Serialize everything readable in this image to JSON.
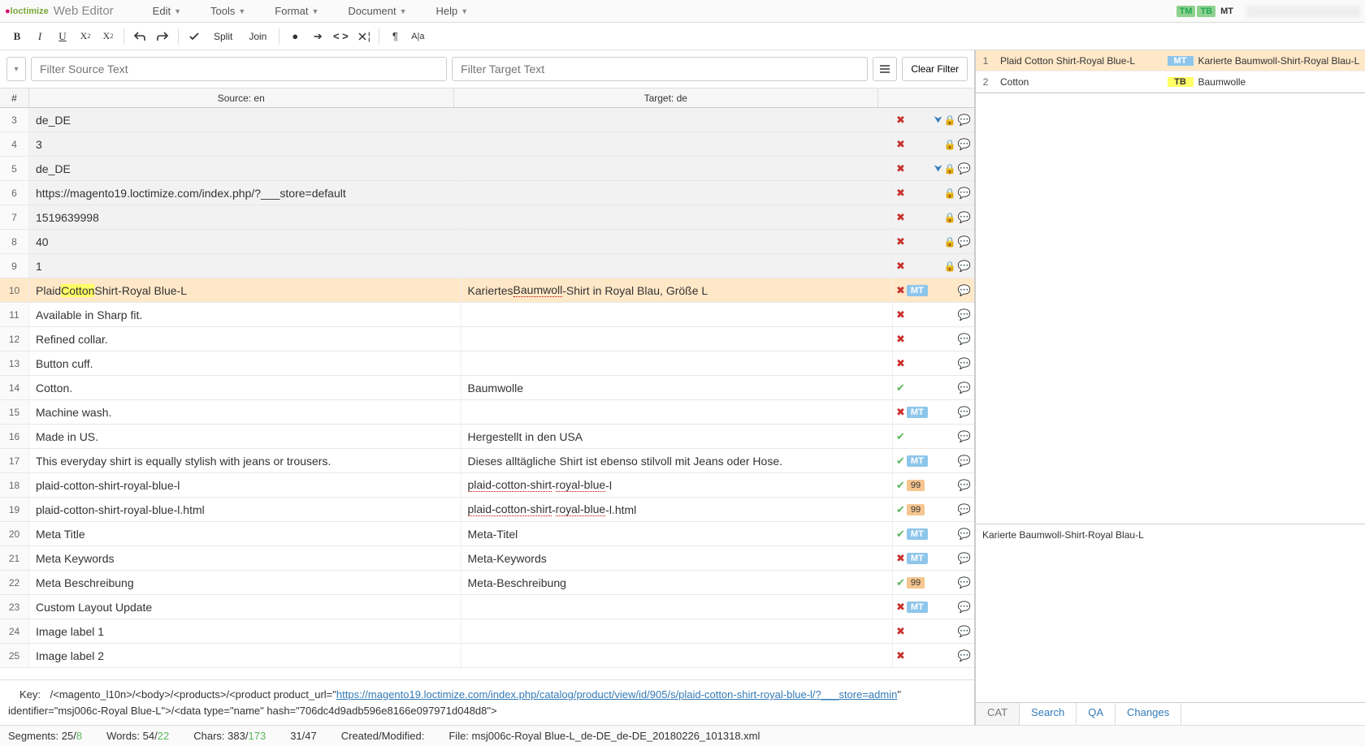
{
  "app": {
    "logo_prefix": "loctimize",
    "title": "Web Editor"
  },
  "menu": [
    "Edit",
    "Tools",
    "Format",
    "Document",
    "Help"
  ],
  "topbadges": [
    "TM",
    "TB",
    "MT"
  ],
  "toolbar": {
    "bold": "B",
    "italic": "I",
    "underline": "U",
    "sub": "X",
    "sup": "X",
    "split": "Split",
    "join": "Join"
  },
  "filters": {
    "source_ph": "Filter Source Text",
    "target_ph": "Filter Target Text",
    "clear": "Clear Filter"
  },
  "grid_head": {
    "num": "#",
    "source": "Source: en",
    "target": "Target: de"
  },
  "rows": [
    {
      "n": 3,
      "src": "de_DE",
      "tgt": "",
      "status": "x",
      "locked": true,
      "lock": true,
      "dbl": true
    },
    {
      "n": 4,
      "src": "3",
      "tgt": "",
      "status": "x",
      "locked": true,
      "lock": true
    },
    {
      "n": 5,
      "src": "de_DE",
      "tgt": "",
      "status": "x",
      "locked": true,
      "lock": true,
      "dbl": true
    },
    {
      "n": 6,
      "src": "https://magento19.loctimize.com/index.php/?___store=default",
      "tgt": "",
      "status": "x",
      "locked": true,
      "lock": true
    },
    {
      "n": 7,
      "src": "1519639998",
      "tgt": "",
      "status": "x",
      "locked": true,
      "lock": true
    },
    {
      "n": 8,
      "src": "40",
      "tgt": "",
      "status": "x",
      "locked": true,
      "lock": true
    },
    {
      "n": 9,
      "src": "1",
      "tgt": "",
      "status": "x",
      "locked": true,
      "lock": true
    },
    {
      "n": 10,
      "src_html": "Plaid <span class='hl'>Cotton</span> Shirt-Royal Blue-L",
      "tgt_html": "Kariertes <span class='spell'>Baumwoll</span>-Shirt in Royal Blau, Größe L",
      "status": "x",
      "active": true,
      "tag": "MT"
    },
    {
      "n": 11,
      "src": "Available in Sharp fit.",
      "tgt": "",
      "status": "x"
    },
    {
      "n": 12,
      "src": "Refined collar.",
      "tgt": "",
      "status": "x"
    },
    {
      "n": 13,
      "src": "Button cuff.",
      "tgt": "",
      "status": "x"
    },
    {
      "n": 14,
      "src": "Cotton.",
      "tgt": "Baumwolle",
      "status": "check"
    },
    {
      "n": 15,
      "src": "Machine wash.",
      "tgt": "",
      "status": "x",
      "tag": "MT"
    },
    {
      "n": 16,
      "src": "Made in US.",
      "tgt": "Hergestellt in den USA",
      "status": "check"
    },
    {
      "n": 17,
      "src": "This everyday shirt is equally stylish with jeans or trousers.",
      "tgt": "Dieses alltägliche Shirt ist ebenso stilvoll mit Jeans oder Hose.",
      "status": "check",
      "tag": "MT"
    },
    {
      "n": 18,
      "src": "plaid-cotton-shirt-royal-blue-l",
      "tgt_html": "<span class='spell'>plaid-cotton-shirt</span>-<span class='spell'>royal-blue</span>-l",
      "status": "check",
      "pct": "99"
    },
    {
      "n": 19,
      "src": "plaid-cotton-shirt-royal-blue-l.html",
      "tgt_html": "<span class='spell'>plaid-cotton-shirt</span>-<span class='spell'>royal-blue</span>-l.html",
      "status": "check",
      "pct": "99"
    },
    {
      "n": 20,
      "src": "Meta Title",
      "tgt": "Meta-Titel",
      "status": "check",
      "tag": "MT"
    },
    {
      "n": 21,
      "src": "Meta Keywords",
      "tgt": "Meta-Keywords",
      "status": "x",
      "tag": "MT"
    },
    {
      "n": 22,
      "src": "Meta Beschreibung",
      "tgt": "Meta-Beschreibung",
      "status": "check",
      "pct": "99"
    },
    {
      "n": 23,
      "src": "Custom Layout Update",
      "tgt": "",
      "status": "x",
      "tag": "MT"
    },
    {
      "n": 24,
      "src": "Image label 1",
      "tgt": "",
      "status": "x"
    },
    {
      "n": 25,
      "src": "Image label 2",
      "tgt": "",
      "status": "x"
    }
  ],
  "key": {
    "label": "Key:",
    "pre": "/<magento_l10n>/<body>/<products>/<product product_url=\"",
    "url": "https://magento19.loctimize.com/index.php/catalog/product/view/id/905/s/plaid-cotton-shirt-royal-blue-l/?___store=admin",
    "post": "\" identifier=\"msj006c-Royal Blue-L\">/<data type=\"name\" hash=\"706dc4d9adb596e8166e097971d048d8\">"
  },
  "status": {
    "segments_label": "Segments:",
    "segments": "25",
    "segments_done": "8",
    "words_label": "Words:",
    "words": "54",
    "words_done": "22",
    "chars_label": "Chars:",
    "chars": "383",
    "chars_done": "173",
    "ratio": "31/47",
    "created_label": "Created/Modified:",
    "file_label": "File:",
    "file": "msj006c-Royal Blue-L_de-DE_de-DE_20180226_101318.xml"
  },
  "cat": {
    "rows": [
      {
        "n": 1,
        "src": "Plaid Cotton Shirt-Royal Blue-L",
        "tag": "MT",
        "tagcls": "mt",
        "tgt": "Karierte Baumwoll-Shirt-Royal Blau-L",
        "sel": true
      },
      {
        "n": 2,
        "src": "Cotton",
        "tag": "TB",
        "tagcls": "tb",
        "tgt": "Baumwolle"
      }
    ],
    "preview": "Karierte Baumwoll-Shirt-Royal Blau-L",
    "tabs": [
      "CAT",
      "Search",
      "QA",
      "Changes"
    ]
  }
}
